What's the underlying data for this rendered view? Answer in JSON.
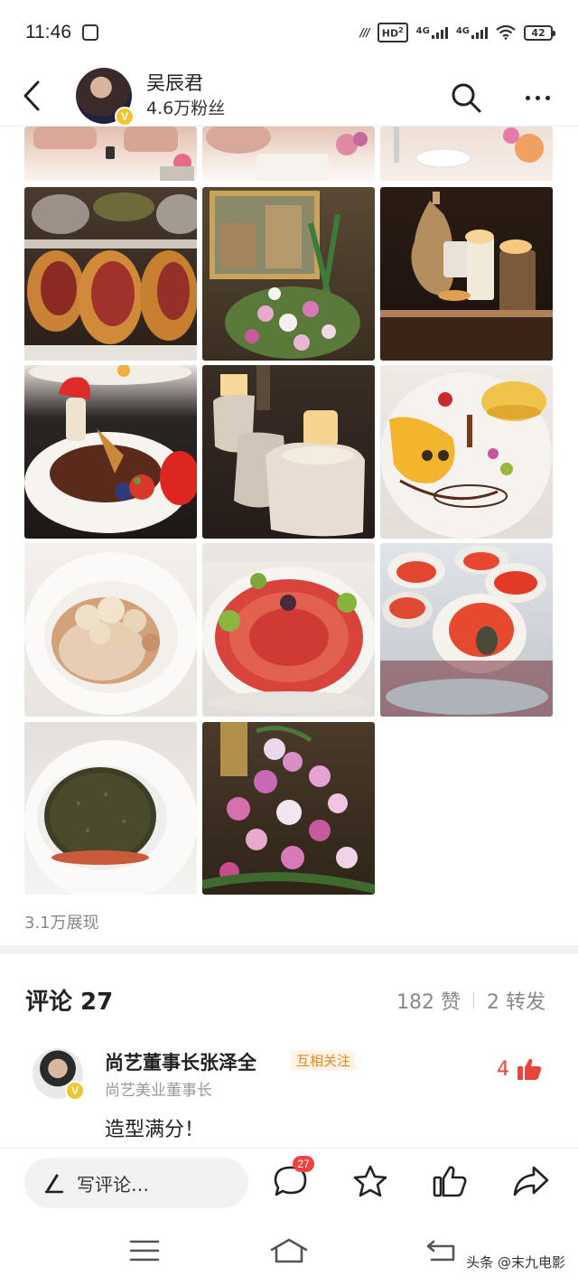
{
  "status_bar": {
    "time": "11:46",
    "network_label_1": "4G",
    "network_label_2": "4G",
    "hd_label": "HD",
    "hd_sub": "2",
    "battery": "42"
  },
  "header": {
    "user_name": "吴辰君",
    "fans": "4.6万粉丝",
    "verified_badge": "V"
  },
  "gallery": {
    "photos": [
      {
        "subject": "dining-people-left",
        "colors": [
          "#e8c6b4",
          "#f5efe9"
        ]
      },
      {
        "subject": "dining-people-middle",
        "colors": [
          "#e9cbbf",
          "#faf6f2"
        ]
      },
      {
        "subject": "table-flowers",
        "colors": [
          "#f1e4dc",
          "#e69a7a"
        ]
      },
      {
        "subject": "beef-wellington",
        "colors": [
          "#c8823c",
          "#7a2a1e"
        ]
      },
      {
        "subject": "flower-arrangement-painting",
        "colors": [
          "#6b5a3c",
          "#e6a9c6"
        ]
      },
      {
        "subject": "candles-vase",
        "colors": [
          "#2a1e16",
          "#c99a5a"
        ]
      },
      {
        "subject": "mushroom-dessert",
        "colors": [
          "#1e1a18",
          "#d8372b"
        ]
      },
      {
        "subject": "ice-candles",
        "colors": [
          "#2a2420",
          "#e7d7c8"
        ]
      },
      {
        "subject": "yellow-dessert",
        "colors": [
          "#eae6e2",
          "#f0b23a"
        ]
      },
      {
        "subject": "truffle-dish",
        "colors": [
          "#f7f5f2",
          "#c89a6a"
        ]
      },
      {
        "subject": "jamon-plate",
        "colors": [
          "#f3f0ee",
          "#c93a3a"
        ]
      },
      {
        "subject": "oysters",
        "colors": [
          "#d9dde2",
          "#e24631"
        ]
      },
      {
        "subject": "caviar-bowl",
        "colors": [
          "#f4f2ef",
          "#3d3e26"
        ]
      },
      {
        "subject": "orchid-flowers",
        "colors": [
          "#4a3a2a",
          "#d97fbf"
        ]
      }
    ]
  },
  "post": {
    "impressions": "3.1万展现"
  },
  "comments": {
    "title": "评论 27",
    "likes": "182 赞",
    "reposts": "2 转发",
    "items": [
      {
        "name": "尚艺董事长张泽全",
        "tag": "互相关注",
        "subtitle": "尚艺美业董事长",
        "text": "造型满分！",
        "likes": "4",
        "verified_badge": "V"
      }
    ]
  },
  "bottom_bar": {
    "write_placeholder": "写评论…",
    "comment_count": "27"
  },
  "watermark": "头条 @末九电影",
  "colors": {
    "accent_red": "#f04142",
    "tag_orange": "#e0892b",
    "verified_gold": "#f4c430"
  }
}
